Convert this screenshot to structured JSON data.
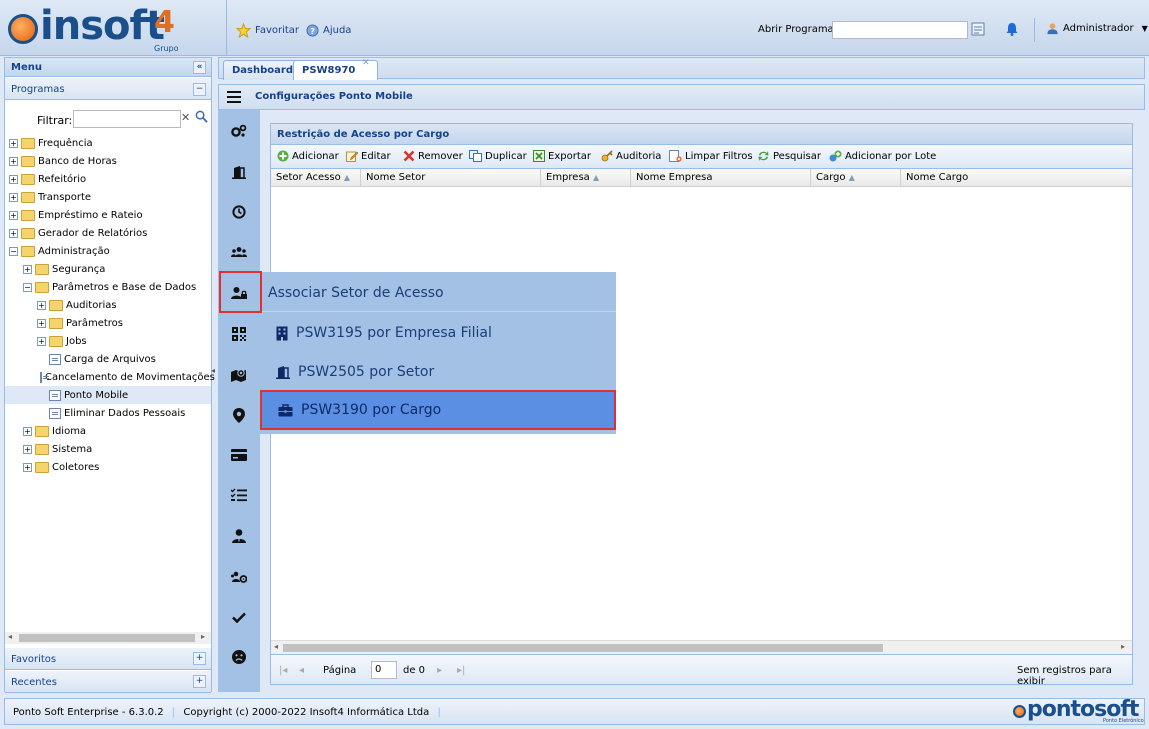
{
  "header": {
    "logo_text": "insoft",
    "logo_number": "4",
    "logo_sub": "Grupo",
    "favoritar": "Favoritar",
    "ajuda": "Ajuda",
    "abrir_programa_label": "Abrir Programa:",
    "abrir_programa_value": "",
    "user": "Administrador"
  },
  "left_panel": {
    "menu_title": "Menu",
    "programas_title": "Programas",
    "filter_label": "Filtrar:",
    "filter_value": "",
    "tree": [
      {
        "label": "Frequência",
        "level": 0,
        "type": "folder",
        "exp": "+"
      },
      {
        "label": "Banco de Horas",
        "level": 0,
        "type": "folder",
        "exp": "+"
      },
      {
        "label": "Refeitório",
        "level": 0,
        "type": "folder",
        "exp": "+"
      },
      {
        "label": "Transporte",
        "level": 0,
        "type": "folder",
        "exp": "+"
      },
      {
        "label": "Empréstimo e Rateio",
        "level": 0,
        "type": "folder",
        "exp": "+"
      },
      {
        "label": "Gerador de Relatórios",
        "level": 0,
        "type": "folder",
        "exp": "+"
      },
      {
        "label": "Administração",
        "level": 0,
        "type": "folder",
        "exp": "−"
      },
      {
        "label": "Segurança",
        "level": 1,
        "type": "folder",
        "exp": "+"
      },
      {
        "label": "Parâmetros e Base de Dados",
        "level": 1,
        "type": "folder",
        "exp": "−"
      },
      {
        "label": "Auditorias",
        "level": 2,
        "type": "folder",
        "exp": "+"
      },
      {
        "label": "Parâmetros",
        "level": 2,
        "type": "folder",
        "exp": "+"
      },
      {
        "label": "Jobs",
        "level": 2,
        "type": "folder",
        "exp": "+"
      },
      {
        "label": "Carga de Arquivos",
        "level": 2,
        "type": "leaf",
        "exp": ""
      },
      {
        "label": "Cancelamento de Movimentações",
        "level": 2,
        "type": "leaf",
        "exp": ""
      },
      {
        "label": "Ponto Mobile",
        "level": 2,
        "type": "leaf",
        "exp": "",
        "selected": true
      },
      {
        "label": "Eliminar Dados Pessoais",
        "level": 2,
        "type": "leaf",
        "exp": ""
      },
      {
        "label": "Idioma",
        "level": 1,
        "type": "folder",
        "exp": "+"
      },
      {
        "label": "Sistema",
        "level": 1,
        "type": "folder",
        "exp": "+"
      },
      {
        "label": "Coletores",
        "level": 1,
        "type": "folder",
        "exp": "+"
      }
    ],
    "favoritos": "Favoritos",
    "recentes": "Recentes"
  },
  "tabs": [
    {
      "label": "Dashboard"
    },
    {
      "label": "PSW8970"
    }
  ],
  "page_title": "Configurações Ponto Mobile",
  "grid": {
    "title": "Restrição de Acesso por Cargo",
    "toolbar": {
      "adicionar": "Adicionar",
      "editar": "Editar",
      "remover": "Remover",
      "duplicar": "Duplicar",
      "exportar": "Exportar",
      "auditoria": "Auditoria",
      "limpar_filtros": "Limpar Filtros",
      "pesquisar": "Pesquisar",
      "adicionar_lote": "Adicionar por Lote"
    },
    "columns": [
      "Setor Acesso",
      "Nome Setor",
      "Empresa",
      "Nome Empresa",
      "Cargo",
      "Nome Cargo"
    ],
    "pager": {
      "pagina": "Página",
      "page_value": "0",
      "de": "de 0",
      "empty": "Sem registros para exibir"
    }
  },
  "flyout": {
    "title": "Associar Setor de Acesso",
    "items": [
      {
        "label": "PSW3195 por Empresa Filial"
      },
      {
        "label": "PSW2505 por Setor"
      },
      {
        "label": "PSW3190 por Cargo"
      }
    ]
  },
  "footer": {
    "version": "Ponto Soft Enterprise - 6.3.0.2",
    "copyright": "Copyright (c) 2000-2022 Insoft4 Informática Ltda",
    "brand": "pontosoft",
    "brand_sub": "Ponto Eletrônico"
  },
  "colors": {
    "accent": "#15428b",
    "highlight": "#5b8fe3",
    "selection_border": "#e03030",
    "icon_bar": "#a3c0e5"
  }
}
